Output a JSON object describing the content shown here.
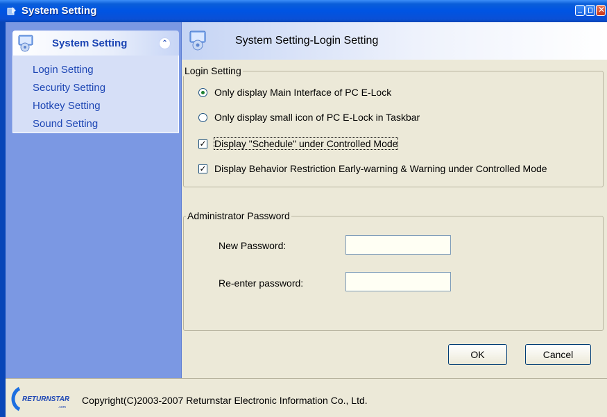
{
  "window": {
    "title": "System Setting",
    "icon": "app-icon"
  },
  "sidebar": {
    "title": "System Setting",
    "collapse_icon": "double-chevron-up-icon",
    "items": [
      {
        "label": "Login Setting"
      },
      {
        "label": "Security Setting"
      },
      {
        "label": "Hotkey Setting"
      },
      {
        "label": "Sound Setting"
      }
    ]
  },
  "main": {
    "header_title": "System Setting-Login Setting",
    "login_group": {
      "legend": "Login Setting",
      "radio_main": "Only display Main Interface of PC E-Lock",
      "radio_small": "Only display small icon of PC E-Lock in Taskbar",
      "radio_selected": "radio_main",
      "chk_schedule": "Display \"Schedule\" under Controlled Mode",
      "chk_schedule_checked": true,
      "chk_behavior": "Display Behavior Restriction Early-warning & Warning under Controlled Mode",
      "chk_behavior_checked": true
    },
    "admin_group": {
      "legend": "Administrator Password",
      "new_password_label": "New Password:",
      "new_password_value": "",
      "reenter_label": "Re-enter password:",
      "reenter_value": ""
    },
    "ok_label": "OK",
    "cancel_label": "Cancel"
  },
  "footer": {
    "logo_text": "RETURNSTAR",
    "copyright": "Copyright(C)2003-2007 Returnstar Electronic Information Co., Ltd."
  },
  "colors": {
    "titlebar": "#0054e3",
    "sidebar_bg": "#7b98e3",
    "panel_bg": "#ece9d8",
    "link": "#1d46b4"
  }
}
